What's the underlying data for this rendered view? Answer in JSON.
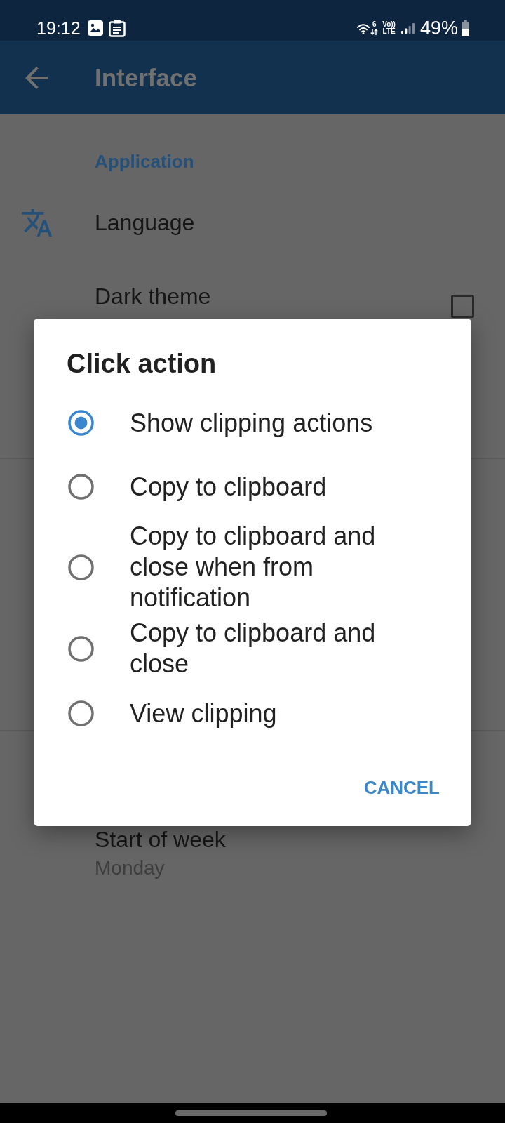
{
  "status_bar": {
    "time": "19:12",
    "wifi_label": "6",
    "network_label": [
      "Vo))",
      "LTE"
    ],
    "battery": "49%"
  },
  "app_bar": {
    "title": "Interface"
  },
  "sections": [
    {
      "header": "Application",
      "items": [
        {
          "kind": "link",
          "title": "Language"
        },
        {
          "kind": "checkbox",
          "title": "Dark theme",
          "checked": false
        }
      ]
    },
    {
      "items": [
        {
          "kind": "value",
          "title": "Start of week",
          "value": "Monday"
        }
      ]
    }
  ],
  "dialog": {
    "title": "Click action",
    "options": [
      {
        "label": "Show clipping actions",
        "selected": true
      },
      {
        "label": "Copy to clipboard",
        "selected": false
      },
      {
        "label": "Copy to clipboard and close when from notification",
        "selected": false
      },
      {
        "label": "Copy to clipboard and close",
        "selected": false
      },
      {
        "label": "View clipping",
        "selected": false
      }
    ],
    "buttons": [
      "CANCEL"
    ]
  }
}
